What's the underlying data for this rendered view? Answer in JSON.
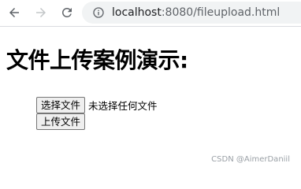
{
  "browser": {
    "url_host": "localhost",
    "url_rest": ":8080/fileupload.html",
    "icons": {
      "back": "arrow-left-icon",
      "forward": "arrow-right-icon",
      "reload": "reload-icon",
      "info": "info-icon"
    }
  },
  "page": {
    "heading": "文件上传案例演示:",
    "choose_file_label": "选择文件",
    "no_file_text": "未选择任何文件",
    "upload_label": "上传文件"
  },
  "watermark": "CSDN @AimerDaniil",
  "colors": {
    "toolbar_icon": "#5f6368",
    "forward_disabled": "#c4c7c9",
    "addressbar_bg": "#f1f3f4",
    "button_bg": "#efefef",
    "button_border": "#767676"
  }
}
